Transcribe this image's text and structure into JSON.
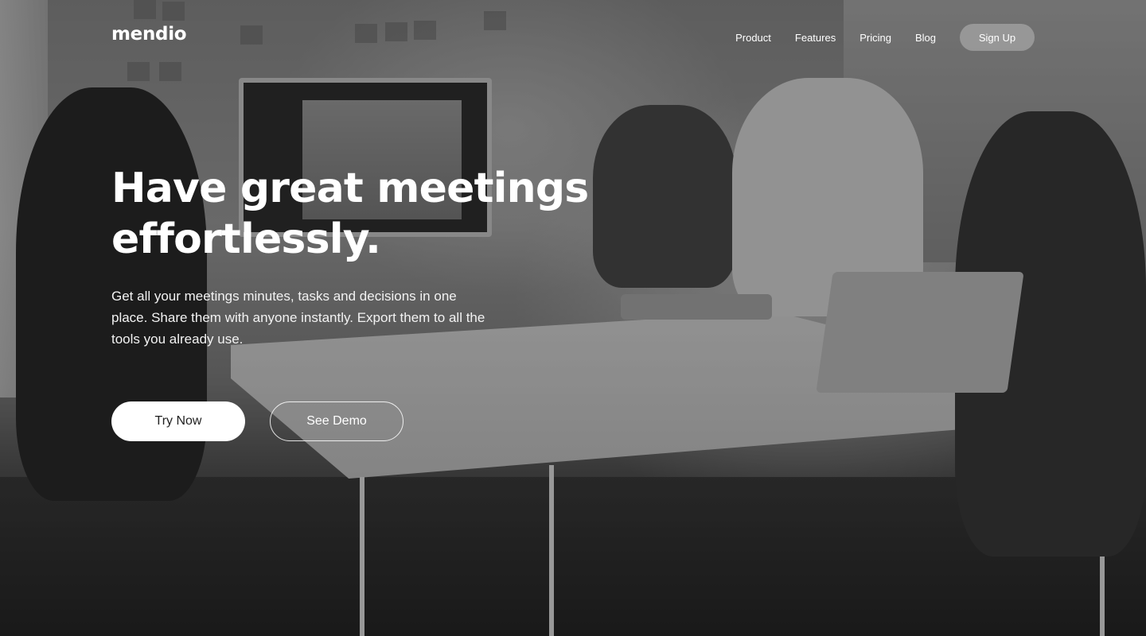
{
  "brand": {
    "logo_text": "mendio"
  },
  "nav": {
    "links": [
      "Product",
      "Features",
      "Pricing",
      "Blog"
    ],
    "signup_label": "Sign Up"
  },
  "hero": {
    "headline_line1": "Have great meetings",
    "headline_line2": "effortlessly.",
    "subtext": "Get all your meetings minutes, tasks and decisions in one place. Share them with anyone instantly. Export them to all the tools you already use.",
    "primary_cta": "Try Now",
    "secondary_cta": "See Demo"
  },
  "colors": {
    "overlay": "#000000",
    "text": "#ffffff",
    "primary_button_bg": "#ffffff",
    "primary_button_text": "#222222"
  }
}
